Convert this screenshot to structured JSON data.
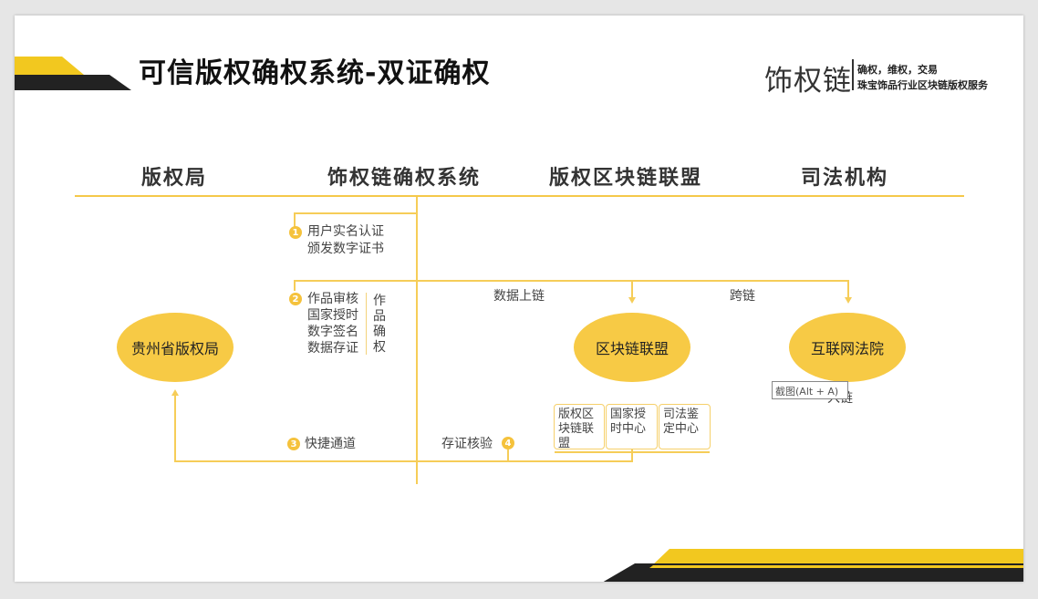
{
  "title": "可信版权确权系统-双证确权",
  "brand": {
    "name": "饰权链",
    "tagline1": "确权，维权，交易",
    "tagline2": "珠宝饰品行业区块链版权服务"
  },
  "columns": [
    "版权局",
    "饰权链确权系统",
    "版权区块链联盟",
    "司法机构"
  ],
  "nodes": {
    "copyright_office": "贵州省版权局",
    "blockchain_alliance": "区块链联盟",
    "internet_court": "互联网法院"
  },
  "steps": {
    "s1_num": "1",
    "s1_line1": "用户实名认证",
    "s1_line2": "颁发数字证书",
    "s2_num": "2",
    "s2_line1": "作品审核",
    "s2_line2": "国家授时",
    "s2_line3": "数字签名",
    "s2_line4": "数据存证",
    "s2_vertical": "作品确权",
    "s3_num": "3",
    "s3_label": "快捷通道",
    "s4_num": "4",
    "s4_label": "存证核验"
  },
  "edge_labels": {
    "data_upload": "数据上链",
    "cross_chain": "跨链",
    "on_chain": "入链"
  },
  "boxes": [
    "版权区块链联盟",
    "国家授时中心",
    "司法鉴定中心"
  ],
  "tooltip": "截图(Alt + A)",
  "colors": {
    "accent": "#f7ca45",
    "line": "#f6cd58",
    "dark": "#222222"
  }
}
